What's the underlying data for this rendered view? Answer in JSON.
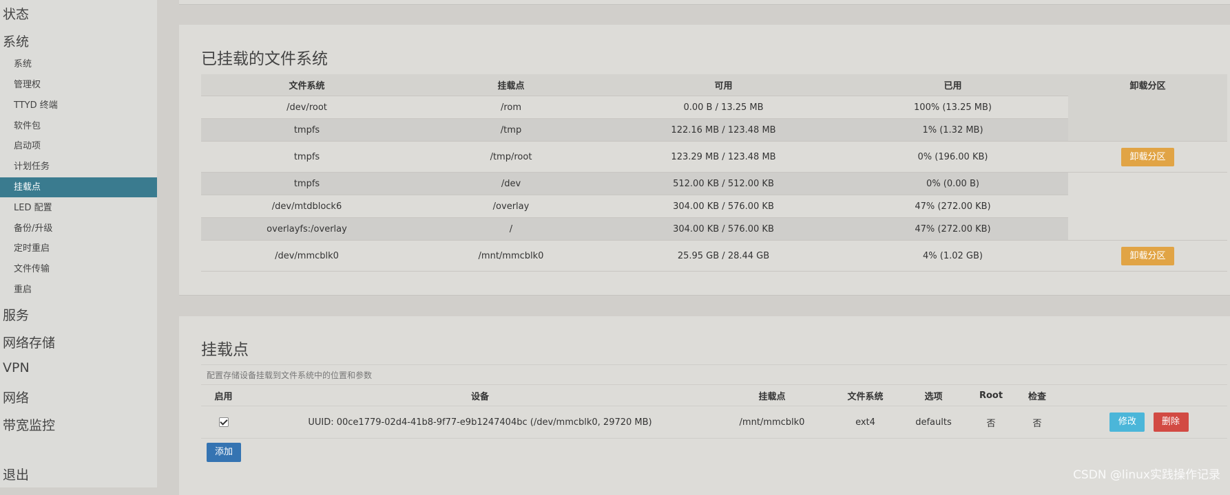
{
  "sidebar": {
    "top_items": [
      "状态",
      "系统"
    ],
    "sub_items": [
      "系统",
      "管理权",
      "TTYD 终端",
      "软件包",
      "启动项",
      "计划任务",
      "挂载点",
      "LED 配置",
      "备份/升级",
      "定时重启",
      "文件传输",
      "重启"
    ],
    "active_sub": "挂载点",
    "bottom_items": [
      "服务",
      "网络存储",
      "VPN",
      "网络",
      "带宽监控"
    ],
    "logout": "退出"
  },
  "mounted": {
    "title": "已挂载的文件系统",
    "headers": [
      "文件系统",
      "挂载点",
      "可用",
      "已用",
      "卸载分区"
    ],
    "rows": [
      {
        "fs": "/dev/root",
        "mount": "/rom",
        "avail": "0.00 B / 13.25 MB",
        "used": "100% (13.25 MB)",
        "action": ""
      },
      {
        "fs": "tmpfs",
        "mount": "/tmp",
        "avail": "122.16 MB / 123.48 MB",
        "used": "1% (1.32 MB)",
        "action": ""
      },
      {
        "fs": "tmpfs",
        "mount": "/tmp/root",
        "avail": "123.29 MB / 123.48 MB",
        "used": "0% (196.00 KB)",
        "action": "卸载分区"
      },
      {
        "fs": "tmpfs",
        "mount": "/dev",
        "avail": "512.00 KB / 512.00 KB",
        "used": "0% (0.00 B)",
        "action": ""
      },
      {
        "fs": "/dev/mtdblock6",
        "mount": "/overlay",
        "avail": "304.00 KB / 576.00 KB",
        "used": "47% (272.00 KB)",
        "action": ""
      },
      {
        "fs": "overlayfs:/overlay",
        "mount": "/",
        "avail": "304.00 KB / 576.00 KB",
        "used": "47% (272.00 KB)",
        "action": ""
      },
      {
        "fs": "/dev/mmcblk0",
        "mount": "/mnt/mmcblk0",
        "avail": "25.95 GB / 28.44 GB",
        "used": "4% (1.02 GB)",
        "action": "卸载分区"
      }
    ]
  },
  "mountpoints": {
    "title": "挂载点",
    "description": "配置存储设备挂载到文件系统中的位置和参数",
    "headers": [
      "启用",
      "设备",
      "挂载点",
      "文件系统",
      "选项",
      "Root",
      "检查"
    ],
    "row": {
      "enabled": true,
      "device": "UUID: 00ce1779-02d4-41b8-9f77-e9b1247404bc (/dev/mmcblk0, 29720 MB)",
      "mount": "/mnt/mmcblk0",
      "fs": "ext4",
      "options": "defaults",
      "root": "否",
      "check": "否",
      "edit": "修改",
      "delete": "删除"
    },
    "add": "添加"
  },
  "watermark": "CSDN @linux实践操作记录",
  "colors": {
    "active": "#3a7b8f",
    "unmount": "#e1a445",
    "edit": "#4bb6d9",
    "delete": "#d24a43",
    "add": "#3574b2"
  }
}
